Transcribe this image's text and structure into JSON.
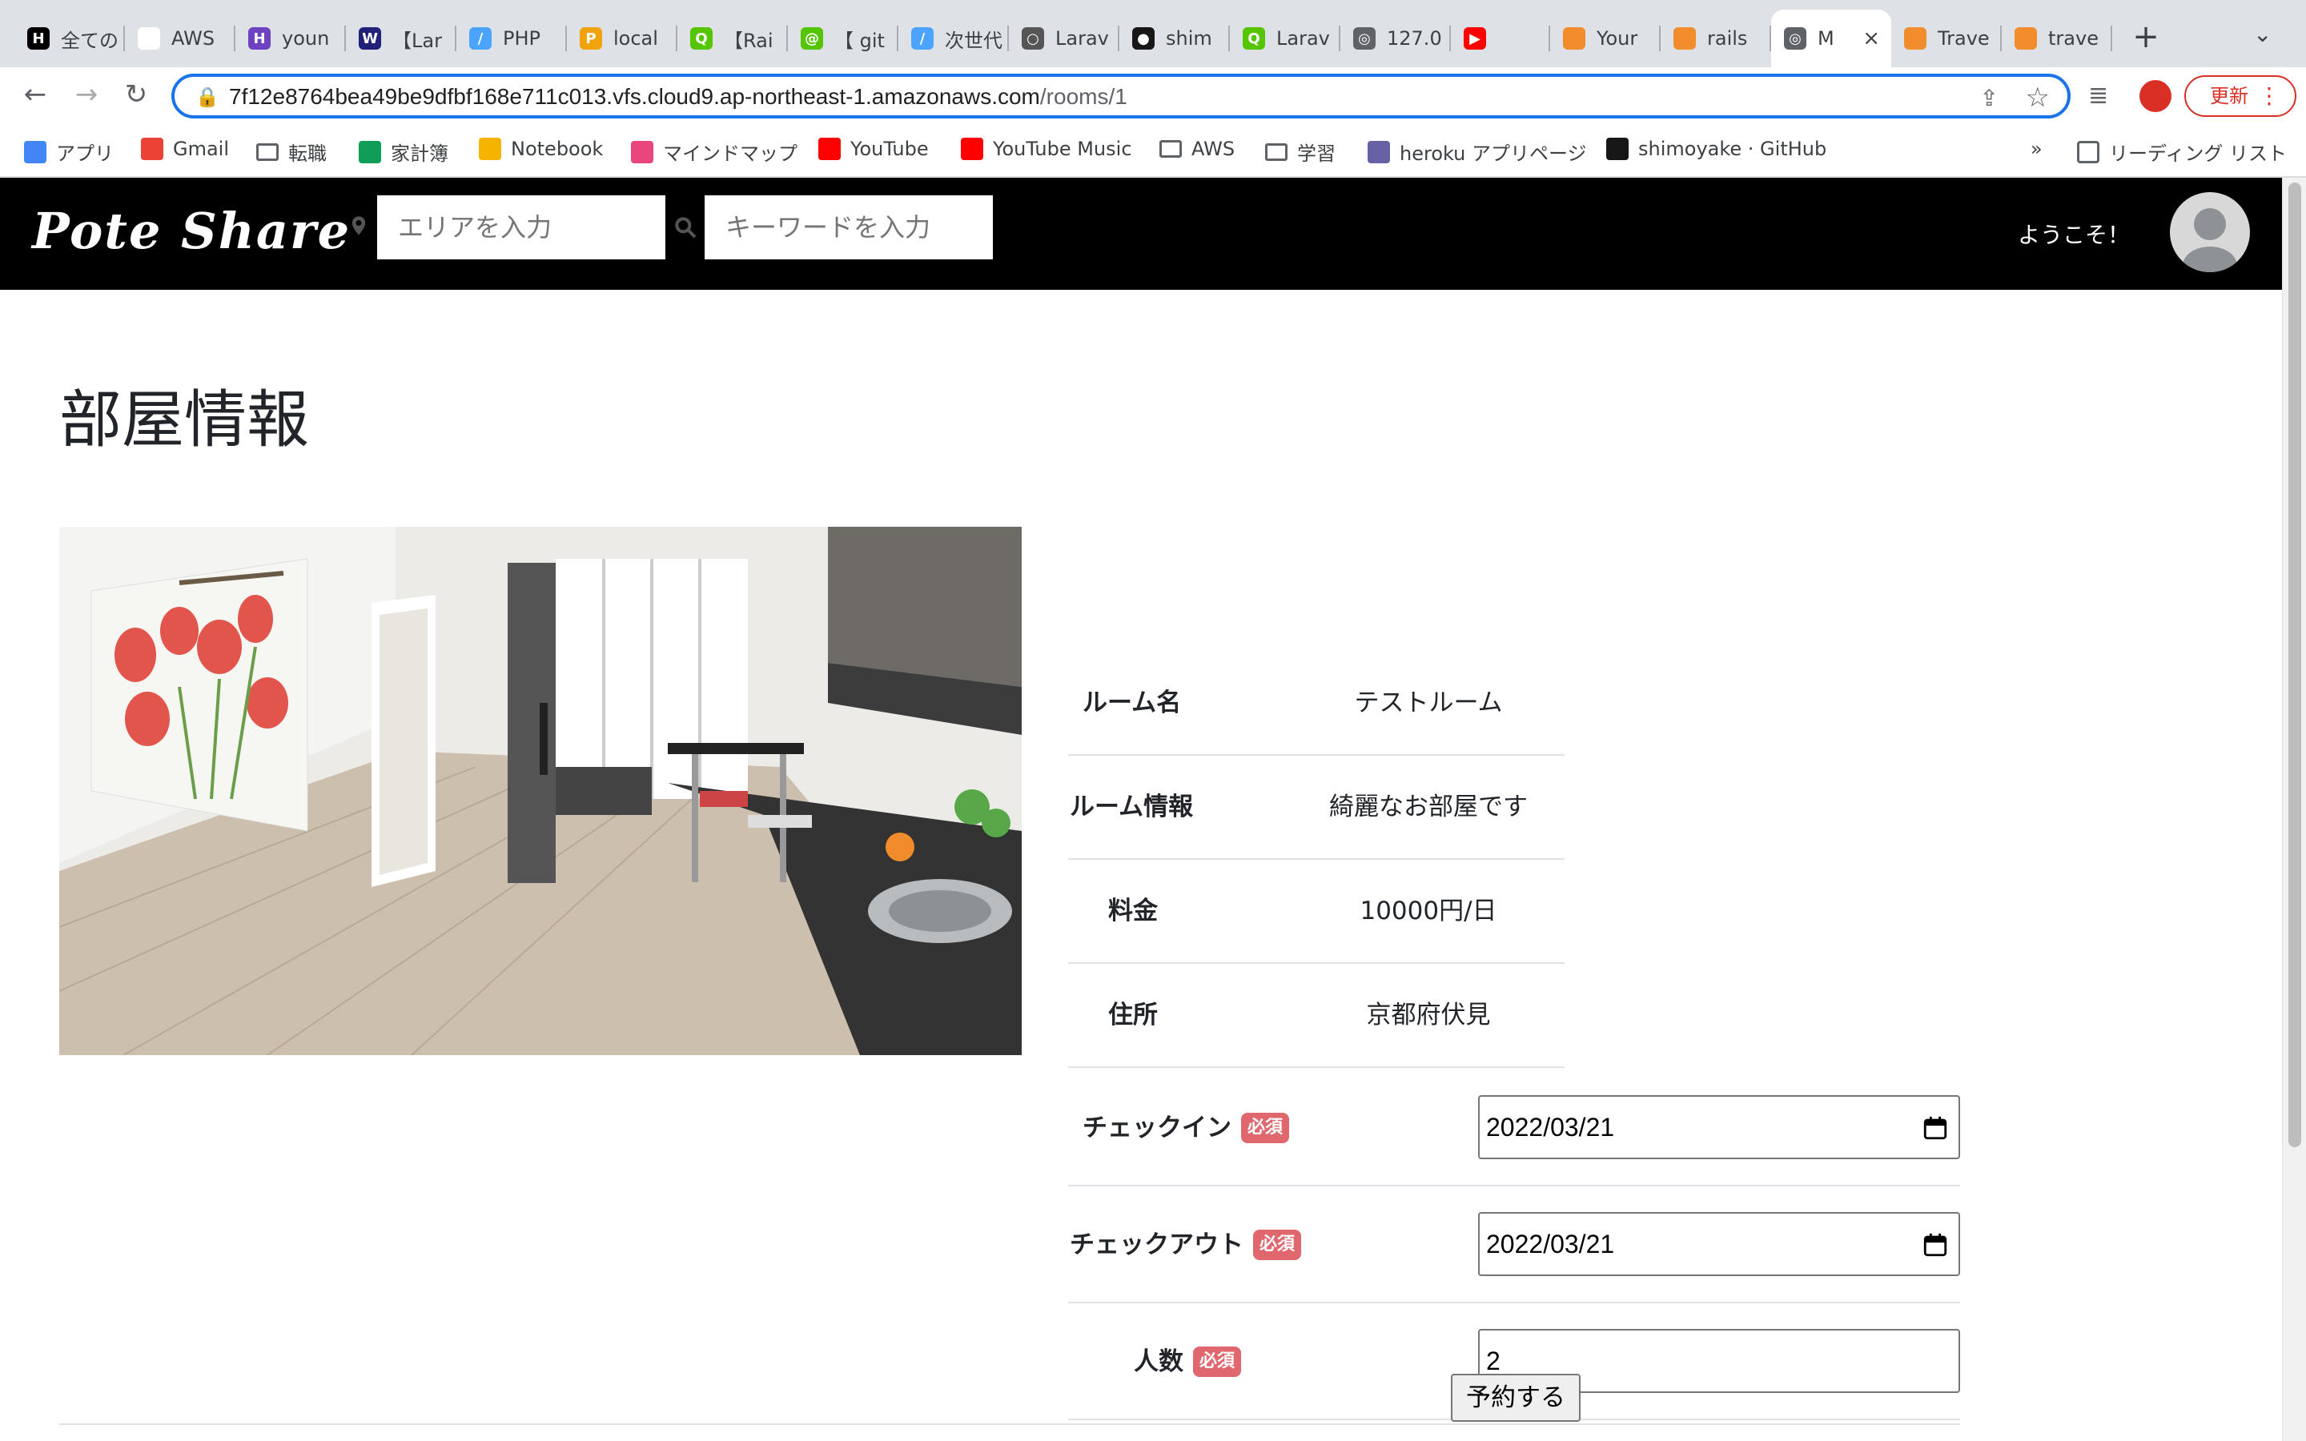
{
  "browser": {
    "tabs": [
      {
        "label": "全ての",
        "color": "#000000",
        "glyph": "H"
      },
      {
        "label": "AWS",
        "color": "#ffffff",
        "glyph": "▶"
      },
      {
        "label": "youn",
        "color": "#6f42c1",
        "glyph": "H"
      },
      {
        "label": "【Lar",
        "color": "#21217a",
        "glyph": "W"
      },
      {
        "label": "PHP",
        "color": "#4aa3ff",
        "glyph": "/"
      },
      {
        "label": "local",
        "color": "#f0a30a",
        "glyph": "P"
      },
      {
        "label": "【Rai",
        "color": "#55c500",
        "glyph": "Q"
      },
      {
        "label": "【 git",
        "color": "#55c500",
        "glyph": "@"
      },
      {
        "label": "次世代",
        "color": "#4aa3ff",
        "glyph": "/"
      },
      {
        "label": "Larav",
        "color": "#555555",
        "glyph": "○"
      },
      {
        "label": "shim",
        "color": "#181717",
        "glyph": "●"
      },
      {
        "label": "Larav",
        "color": "#55c500",
        "glyph": "Q"
      },
      {
        "label": "127.0",
        "color": "#5f6368",
        "glyph": "◎"
      },
      {
        "label": "",
        "color": "#ff0000",
        "glyph": "▶"
      },
      {
        "label": "Your",
        "color": "#f08c2b",
        "glyph": ""
      },
      {
        "label": "rails",
        "color": "#f08c2b",
        "glyph": ""
      },
      {
        "label": "M",
        "color": "#5f6368",
        "glyph": "◎"
      },
      {
        "label": "Trave",
        "color": "#f08c2b",
        "glyph": ""
      },
      {
        "label": "trave",
        "color": "#f08c2b",
        "glyph": ""
      }
    ],
    "url_host": "7f12e8764bea49be9dfbf168e711c013.vfs.cloud9.ap-northeast-1.amazonaws.com",
    "url_path": "/rooms/1",
    "update_label": "更新",
    "bookmarks": [
      {
        "label": "アプリ",
        "icon": "apps-icon",
        "color": "#4285f4"
      },
      {
        "label": "Gmail",
        "icon": "gmail-icon",
        "color": "#ea4335"
      },
      {
        "label": "転職",
        "icon": "folder-icon",
        "color": ""
      },
      {
        "label": "家計簿",
        "icon": "sheets-icon",
        "color": "#0f9d58"
      },
      {
        "label": "Notebook",
        "icon": "notebook-icon",
        "color": "#f4b400"
      },
      {
        "label": "マインドマップ",
        "icon": "mindmap-icon",
        "color": "#e8467c"
      },
      {
        "label": "YouTube",
        "icon": "youtube-icon",
        "color": "#ff0000"
      },
      {
        "label": "YouTube Music",
        "icon": "youtube-music-icon",
        "color": "#ff0000"
      },
      {
        "label": "AWS",
        "icon": "folder-icon",
        "color": ""
      },
      {
        "label": "学習",
        "icon": "folder-icon",
        "color": ""
      },
      {
        "label": "heroku アプリページ",
        "icon": "heroku-icon",
        "color": "#6762a6"
      },
      {
        "label": "shimoyake · GitHub",
        "icon": "github-icon",
        "color": "#181717"
      }
    ],
    "more_bookmarks": "»",
    "reading_list": "リーディング リスト"
  },
  "site": {
    "logo": "Pote Share",
    "area_placeholder": "エリアを入力",
    "keyword_placeholder": "キーワードを入力",
    "welcome": "ようこそ！"
  },
  "page": {
    "title": "部屋情報",
    "info": [
      {
        "label": "ルーム名",
        "value": "テストルーム"
      },
      {
        "label": "ルーム情報",
        "value": "綺麗なお部屋です"
      },
      {
        "label": "料金",
        "value": "10000円/日"
      },
      {
        "label": "住所",
        "value": "京都府伏見"
      }
    ],
    "form": {
      "required_badge": "必須",
      "checkin_label": "チェックイン",
      "checkin_value": "2022/03/21",
      "checkout_label": "チェックアウト",
      "checkout_value": "2022/03/21",
      "people_label": "人数",
      "people_value": "2",
      "submit_label": "予約する"
    }
  }
}
